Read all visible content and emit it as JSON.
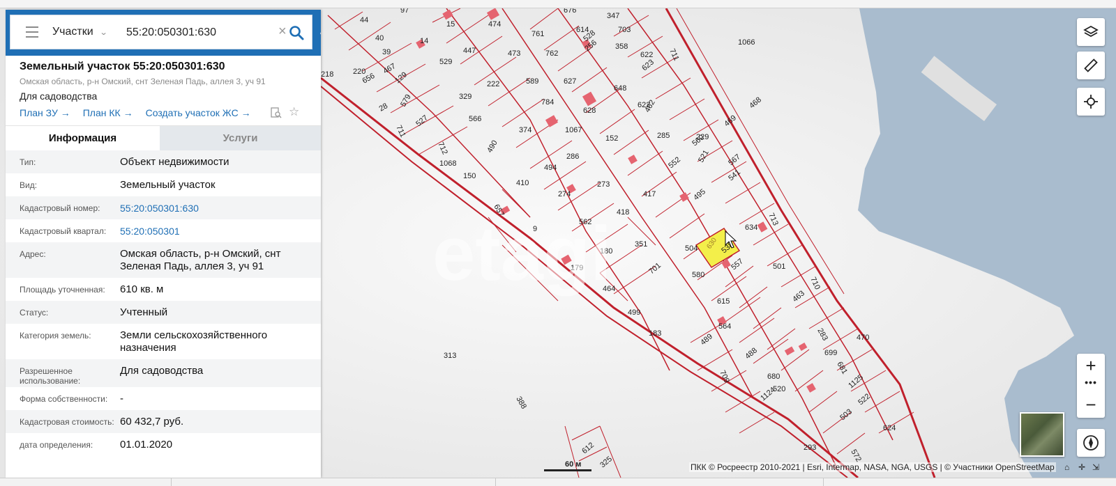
{
  "search": {
    "mode": "Участки",
    "query": "55:20:050301:630"
  },
  "parcel": {
    "title": "Земельный участок 55:20:050301:630",
    "address_short": "Омская область, р-н Омский, снт Зеленая Падь, аллея 3, уч 91",
    "purpose": "Для садоводства",
    "links": [
      "План ЗУ",
      "План КК",
      "Создать участок ЖС"
    ]
  },
  "tabs": {
    "info": "Информация",
    "services": "Услуги"
  },
  "rows": [
    {
      "label": "Тип:",
      "value": "Объект недвижимости",
      "link": false
    },
    {
      "label": "Вид:",
      "value": "Земельный участок",
      "link": false
    },
    {
      "label": "Кадастровый номер:",
      "value": "55:20:050301:630",
      "link": true
    },
    {
      "label": "Кадастровый квартал:",
      "value": "55:20:050301",
      "link": true
    },
    {
      "label": "Адрес:",
      "value": "Омская область, р-н Омский, снт Зеленая Падь, аллея 3, уч 91",
      "link": false
    },
    {
      "label": "Площадь уточненная:",
      "value": "610 кв. м",
      "link": false
    },
    {
      "label": "Статус:",
      "value": "Учтенный",
      "link": false
    },
    {
      "label": "Категория земель:",
      "value": "Земли сельскохозяйственного назначения",
      "link": false
    },
    {
      "label": "Разрешенное использование:",
      "value": "Для садоводства",
      "link": false
    },
    {
      "label": "Форма собственности:",
      "value": "-",
      "link": false
    },
    {
      "label": "Кадастровая стоимость:",
      "value": "60 432,7 руб.",
      "link": false
    },
    {
      "label": "дата определения:",
      "value": "01.01.2020",
      "link": false
    }
  ],
  "map": {
    "attribution": "ПКК © Росреестр 2010-2021 | Esri, Intermap, NASA, NGA, USGS | © Участники OpenStreetMap",
    "scale_label": "60 м",
    "selected_parcel": "630",
    "watermark": "etagi",
    "plot_labels": [
      "44",
      "97",
      "15",
      "474",
      "761",
      "676",
      "614",
      "347",
      "703",
      "711",
      "40",
      "14",
      "447",
      "256",
      "358",
      "622",
      "218",
      "220",
      "39",
      "529",
      "473",
      "762",
      "656",
      "467",
      "129",
      "329",
      "222",
      "589",
      "627",
      "648",
      "623",
      "528",
      "579",
      "28",
      "566",
      "784",
      "628",
      "622",
      "462",
      "1066",
      "527",
      "468",
      "711",
      "229",
      "490",
      "374",
      "1067",
      "152",
      "285",
      "560",
      "469",
      "712",
      "521",
      "1068",
      "286",
      "552",
      "150",
      "494",
      "567",
      "541",
      "410",
      "274",
      "273",
      "417",
      "713",
      "495",
      "657",
      "562",
      "418",
      "9",
      "351",
      "504",
      "634",
      "180",
      "179",
      "701",
      "580",
      "538",
      "501",
      "557",
      "710",
      "464",
      "615",
      "499",
      "463",
      "564",
      "313",
      "183",
      "283",
      "489",
      "699",
      "488",
      "470",
      "709",
      "680",
      "1124",
      "520",
      "681",
      "1125",
      "522",
      "503",
      "624",
      "293",
      "572",
      "612",
      "325",
      "388"
    ],
    "controls": {
      "zoom_in": "+",
      "zoom_more": "•••",
      "zoom_out": "−"
    },
    "colors": {
      "boundary": "#c0202c",
      "selected_fill": "#f3ef4a",
      "building": "#e56470",
      "water": "#a9bcce",
      "panel_header": "#1f6fb5"
    }
  }
}
